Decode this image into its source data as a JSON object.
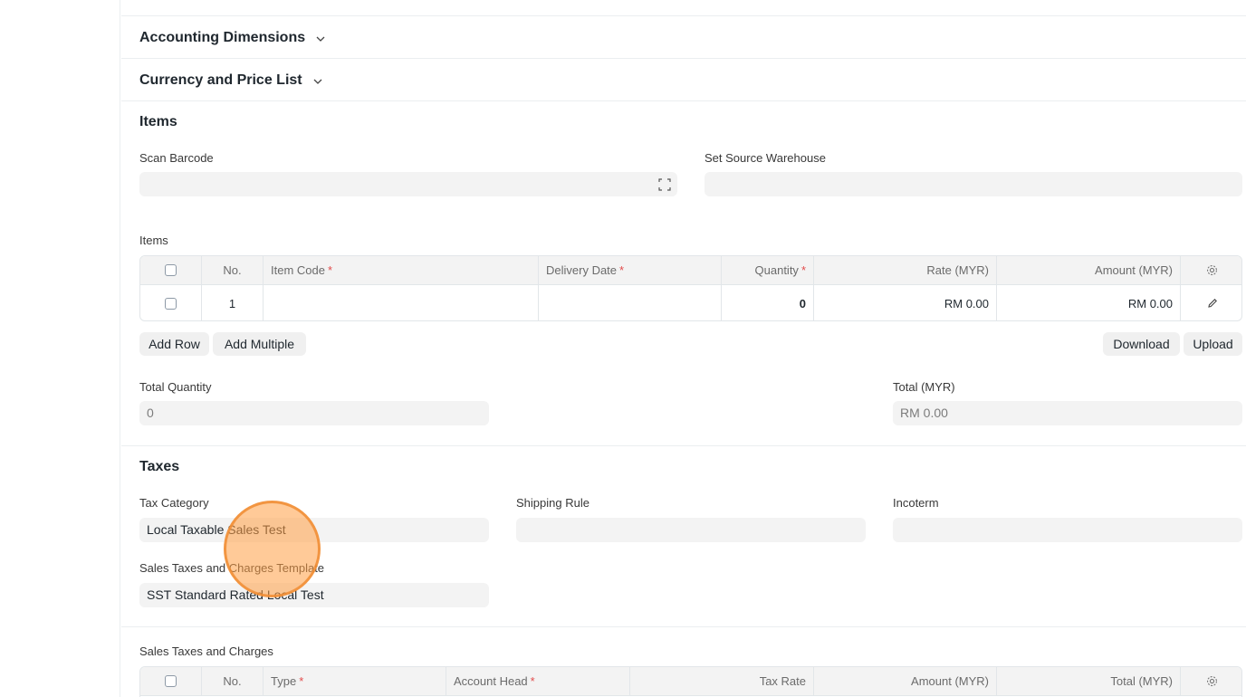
{
  "sections": {
    "accounting_dimensions": "Accounting Dimensions",
    "currency_price_list": "Currency and Price List",
    "items": "Items",
    "taxes": "Taxes"
  },
  "items_section": {
    "scan_barcode_label": "Scan Barcode",
    "scan_barcode_value": "",
    "set_source_warehouse_label": "Set Source Warehouse",
    "set_source_warehouse_value": "",
    "items_table_label": "Items",
    "columns": {
      "no": "No.",
      "item_code": "Item Code",
      "delivery_date": "Delivery Date",
      "quantity": "Quantity",
      "rate": "Rate (MYR)",
      "amount": "Amount (MYR)"
    },
    "rows": [
      {
        "no": "1",
        "item_code": "",
        "delivery_date": "",
        "quantity": "0",
        "rate": "RM 0.00",
        "amount": "RM 0.00"
      }
    ],
    "buttons": {
      "add_row": "Add Row",
      "add_multiple": "Add Multiple",
      "download": "Download",
      "upload": "Upload"
    },
    "total_quantity_label": "Total Quantity",
    "total_quantity_value": "0",
    "total_label": "Total (MYR)",
    "total_value": "RM 0.00"
  },
  "taxes_section": {
    "tax_category_label": "Tax Category",
    "tax_category_value": "Local Taxable Sales Test",
    "shipping_rule_label": "Shipping Rule",
    "shipping_rule_value": "",
    "incoterm_label": "Incoterm",
    "incoterm_value": "",
    "template_label": "Sales Taxes and Charges Template",
    "template_value": "SST Standard Rated Local Test",
    "charges_table_label": "Sales Taxes and Charges",
    "columns": {
      "no": "No.",
      "type": "Type",
      "account_head": "Account Head",
      "tax_rate": "Tax Rate",
      "amount": "Amount (MYR)",
      "total": "Total (MYR)"
    }
  },
  "required_marker": "*",
  "colors": {
    "required": "#e24c4c",
    "input_bg": "#f3f3f3",
    "cursor_highlight": "#ff9f43"
  },
  "icons": {
    "chevron": "chevron-down-icon",
    "scan": "barcode-scan-icon",
    "settings": "gear-icon",
    "edit": "pencil-icon"
  }
}
